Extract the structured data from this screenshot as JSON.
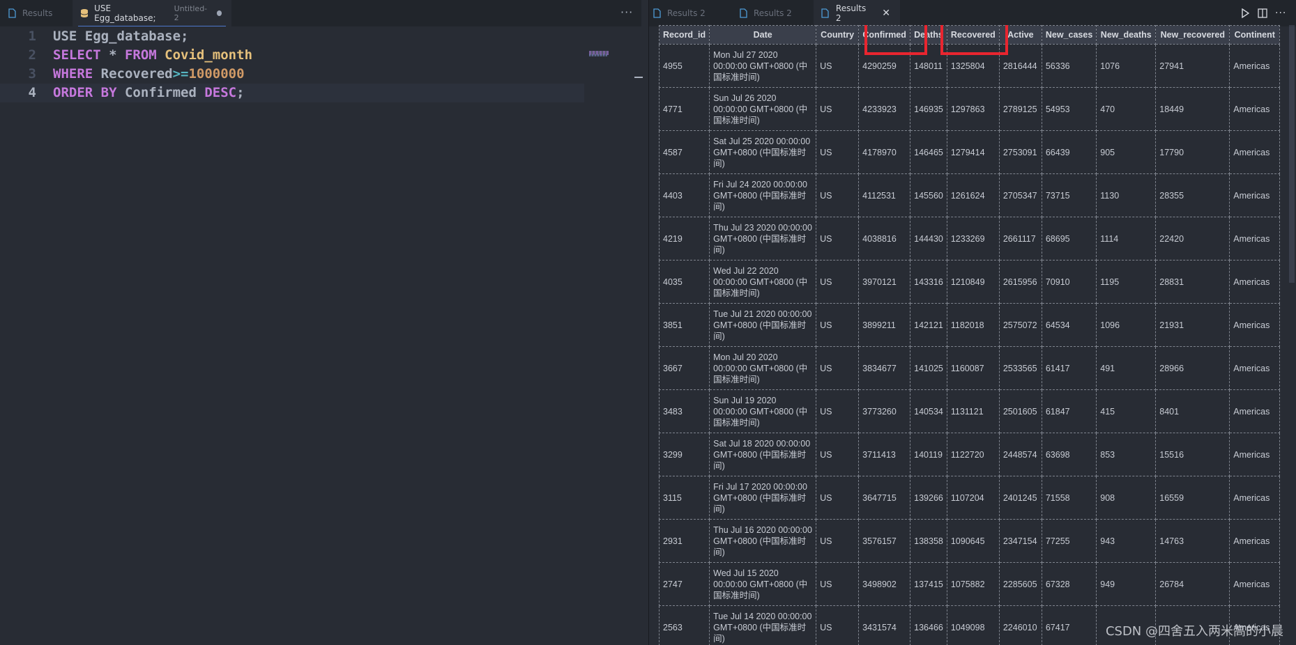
{
  "left_tabs": [
    {
      "label": "Results",
      "sub": "",
      "active": false
    },
    {
      "label": "USE Egg_database;",
      "sub": "Untitled-2",
      "active": true
    }
  ],
  "editor": {
    "lines": [
      {
        "number": "1",
        "tokens": [
          {
            "t": "USE Egg_database;",
            "c": "plain"
          }
        ]
      },
      {
        "number": "2",
        "tokens": [
          {
            "t": "SELECT",
            "c": "kw"
          },
          {
            "t": " * ",
            "c": "plain"
          },
          {
            "t": "FROM",
            "c": "kw"
          },
          {
            "t": " Covid_month",
            "c": "tbl"
          }
        ]
      },
      {
        "number": "3",
        "tokens": [
          {
            "t": "WHERE",
            "c": "kw"
          },
          {
            "t": " Recovered",
            "c": "plain"
          },
          {
            "t": ">=",
            "c": "op"
          },
          {
            "t": "1000000",
            "c": "num"
          }
        ]
      },
      {
        "number": "4",
        "tokens": [
          {
            "t": "ORDER BY",
            "c": "kw"
          },
          {
            "t": " Confirmed ",
            "c": "plain"
          },
          {
            "t": "DESC",
            "c": "kw"
          },
          {
            "t": ";",
            "c": "plain"
          }
        ]
      }
    ],
    "current_line": "4"
  },
  "right_tabs": [
    {
      "label": "Results 2",
      "active": false
    },
    {
      "label": "Results 2",
      "active": false
    },
    {
      "label": "Results 2",
      "active": true
    }
  ],
  "grid": {
    "columns": [
      "Record_id",
      "Date",
      "Country",
      "Confirmed",
      "Deaths",
      "Recovered",
      "Active",
      "New_cases",
      "New_deaths",
      "New_recovered",
      "Continent"
    ],
    "rows": [
      [
        "4955",
        "Mon Jul 27 2020 00:00:00 GMT+0800 (中国标准时间)",
        "US",
        "4290259",
        "148011",
        "1325804",
        "2816444",
        "56336",
        "1076",
        "27941",
        "Americas"
      ],
      [
        "4771",
        "Sun Jul 26 2020 00:00:00 GMT+0800 (中国标准时间)",
        "US",
        "4233923",
        "146935",
        "1297863",
        "2789125",
        "54953",
        "470",
        "18449",
        "Americas"
      ],
      [
        "4587",
        "Sat Jul 25 2020 00:00:00 GMT+0800 (中国标准时间)",
        "US",
        "4178970",
        "146465",
        "1279414",
        "2753091",
        "66439",
        "905",
        "17790",
        "Americas"
      ],
      [
        "4403",
        "Fri Jul 24 2020 00:00:00 GMT+0800 (中国标准时间)",
        "US",
        "4112531",
        "145560",
        "1261624",
        "2705347",
        "73715",
        "1130",
        "28355",
        "Americas"
      ],
      [
        "4219",
        "Thu Jul 23 2020 00:00:00 GMT+0800 (中国标准时间)",
        "US",
        "4038816",
        "144430",
        "1233269",
        "2661117",
        "68695",
        "1114",
        "22420",
        "Americas"
      ],
      [
        "4035",
        "Wed Jul 22 2020 00:00:00 GMT+0800 (中国标准时间)",
        "US",
        "3970121",
        "143316",
        "1210849",
        "2615956",
        "70910",
        "1195",
        "28831",
        "Americas"
      ],
      [
        "3851",
        "Tue Jul 21 2020 00:00:00 GMT+0800 (中国标准时间)",
        "US",
        "3899211",
        "142121",
        "1182018",
        "2575072",
        "64534",
        "1096",
        "21931",
        "Americas"
      ],
      [
        "3667",
        "Mon Jul 20 2020 00:00:00 GMT+0800 (中国标准时间)",
        "US",
        "3834677",
        "141025",
        "1160087",
        "2533565",
        "61417",
        "491",
        "28966",
        "Americas"
      ],
      [
        "3483",
        "Sun Jul 19 2020 00:00:00 GMT+0800 (中国标准时间)",
        "US",
        "3773260",
        "140534",
        "1131121",
        "2501605",
        "61847",
        "415",
        "8401",
        "Americas"
      ],
      [
        "3299",
        "Sat Jul 18 2020 00:00:00 GMT+0800 (中国标准时间)",
        "US",
        "3711413",
        "140119",
        "1122720",
        "2448574",
        "63698",
        "853",
        "15516",
        "Americas"
      ],
      [
        "3115",
        "Fri Jul 17 2020 00:00:00 GMT+0800 (中国标准时间)",
        "US",
        "3647715",
        "139266",
        "1107204",
        "2401245",
        "71558",
        "908",
        "16559",
        "Americas"
      ],
      [
        "2931",
        "Thu Jul 16 2020 00:00:00 GMT+0800 (中国标准时间)",
        "US",
        "3576157",
        "138358",
        "1090645",
        "2347154",
        "77255",
        "943",
        "14763",
        "Americas"
      ],
      [
        "2747",
        "Wed Jul 15 2020 00:00:00 GMT+0800 (中国标准时间)",
        "US",
        "3498902",
        "137415",
        "1075882",
        "2285605",
        "67328",
        "949",
        "26784",
        "Americas"
      ],
      [
        "2563",
        "Tue Jul 14 2020 00:00:00 GMT+0800 (中国标准时间)",
        "US",
        "3431574",
        "136466",
        "1049098",
        "2246010",
        "67417",
        "",
        "",
        "Americas"
      ]
    ]
  },
  "watermark": "CSDN @四舍五入两米高的小晨"
}
